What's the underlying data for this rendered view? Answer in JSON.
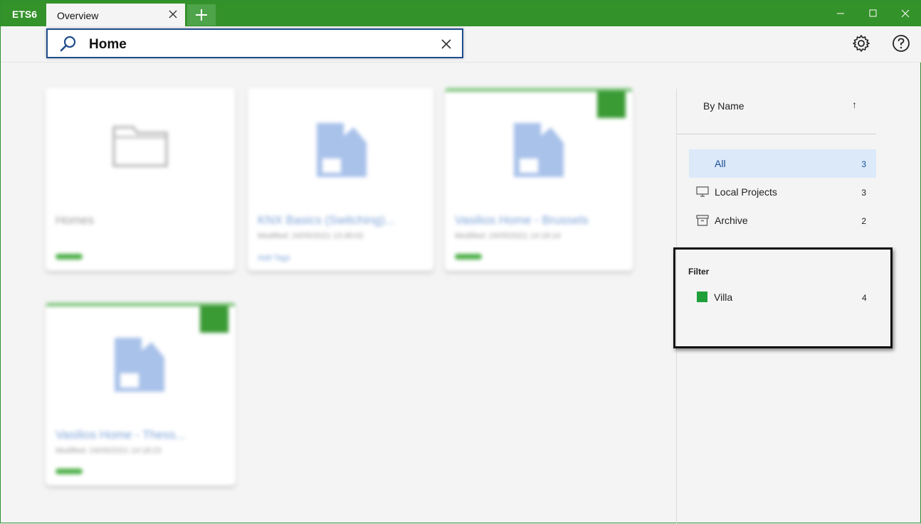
{
  "app": {
    "title": "ETS6"
  },
  "tabs": [
    {
      "label": "Overview"
    }
  ],
  "search": {
    "value": "Home"
  },
  "colors": {
    "accent": "#34922a",
    "selected": "#dbe9f9",
    "villa_tag": "#1f9f3a"
  },
  "projects": [
    {
      "name": "Homes",
      "subtitle": "",
      "tag": "green-bar",
      "checked": false,
      "icon": "folder-icon"
    },
    {
      "name": "KNX Basics (Switching)...",
      "subtitle": "Modified: 24/05/2021 13:48:02",
      "tag_text": "Add Tags",
      "checked": false,
      "icon": "building-icon"
    },
    {
      "name": "Vasilios Home - Brussels",
      "subtitle": "Modified: 24/05/2021 14:18:14",
      "tag": "green-bar",
      "checked": true,
      "icon": "building-icon"
    },
    {
      "name": "Vasilios Home - Thess...",
      "subtitle": "Modified: 24/05/2021 14:18:23",
      "tag": "green-bar",
      "checked": true,
      "icon": "building-icon"
    }
  ],
  "sidebar": {
    "sort": {
      "label": "By Name",
      "arrow": "↑"
    },
    "items": [
      {
        "label": "All",
        "count": "3",
        "icon": ""
      },
      {
        "label": "Local Projects",
        "count": "3",
        "icon": "monitor-icon"
      },
      {
        "label": "Archive",
        "count": "2",
        "icon": "archive-box-icon"
      }
    ],
    "filter": {
      "title": "Filter",
      "items": [
        {
          "label": "Villa",
          "count": "4",
          "color": "#1f9f3a"
        }
      ]
    }
  }
}
